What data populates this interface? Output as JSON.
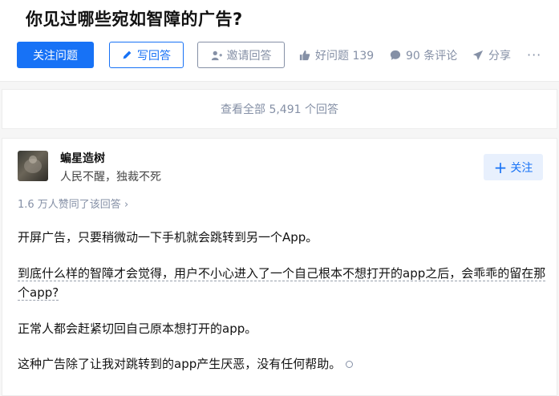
{
  "question": {
    "title": "你见过哪些宛如智障的广告?"
  },
  "actions": {
    "follow_question": "关注问题",
    "write_answer": "写回答",
    "invite_answer": "邀请回答",
    "good_question": "好问题 139",
    "comments": "90 条评论",
    "share": "分享",
    "more": "···"
  },
  "view_all": "查看全部 5,491 个回答",
  "answer": {
    "author_name": "蝙星造树",
    "author_bio": "人民不醒，独裁不死",
    "follow_label": "关注",
    "votes_text": "1.6 万人赞同了该回答 ›",
    "paragraphs": [
      "开屏广告，只要稍微动一下手机就会跳转到另一个App。",
      "到底什么样的智障才会觉得，用户不小心进入了一个自己根本不想打开的app之后，会乖乖的留在那个app?",
      "正常人都会赶紧切回自己原本想打开的app。",
      "这种广告除了让我对跳转到的app产生厌恶，没有任何帮助。"
    ]
  },
  "colors": {
    "brand": "#1772f6",
    "muted": "#8590a6",
    "background": "#f6f6f6"
  },
  "icons": [
    "pen-icon",
    "person-plus-icon",
    "thumb-up-icon",
    "comment-icon",
    "share-icon",
    "more-icon",
    "plus-icon"
  ]
}
